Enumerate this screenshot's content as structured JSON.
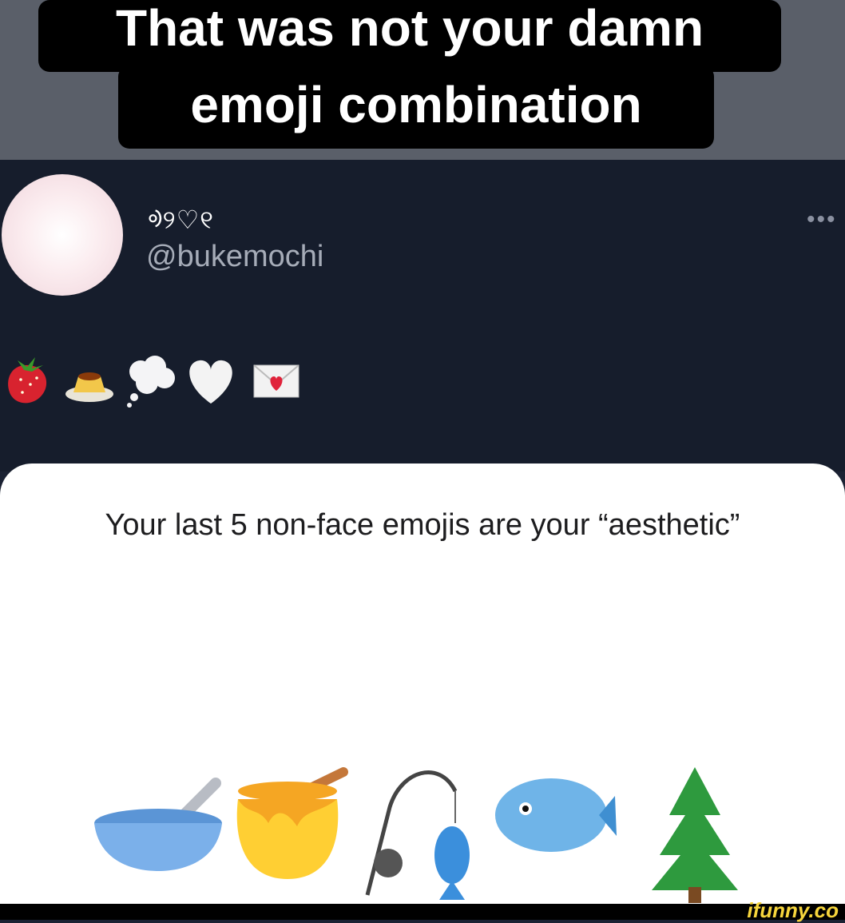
{
  "caption": {
    "line1": "That was not your damn",
    "line2": "emoji combination"
  },
  "tweet": {
    "display_name": "ᢀ୨♡୧",
    "handle": "@bukemochi",
    "more_icon": "ellipsis-icon",
    "emojis": [
      "strawberry",
      "custard",
      "thought-balloon",
      "white-heart",
      "love-letter"
    ]
  },
  "card": {
    "text": "Your last 5 non-face emojis are your “aesthetic”",
    "emojis": [
      "bowl-with-spoon",
      "honey-pot",
      "fishing-pole",
      "fish",
      "evergreen-tree"
    ]
  },
  "watermark": "ifunny.co"
}
